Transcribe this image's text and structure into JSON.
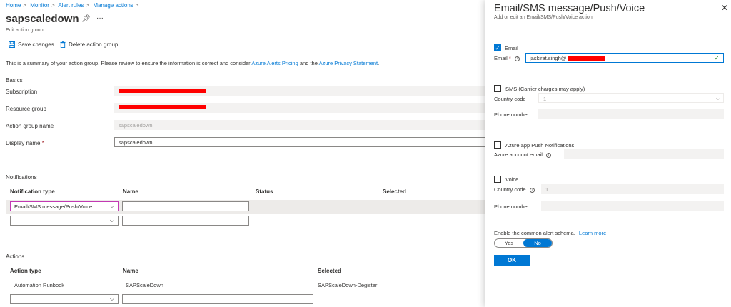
{
  "breadcrumb": [
    "Home",
    "Monitor",
    "Alert rules",
    "Manage actions"
  ],
  "page": {
    "title": "sapscaledown",
    "subtitle": "Edit action group"
  },
  "toolbar": {
    "save_label": "Save changes",
    "delete_label": "Delete action group"
  },
  "summary": {
    "text_before": "This is a summary of your action group. Please review to ensure the information is correct and consider ",
    "link1": "Azure Alerts Pricing",
    "text_mid": " and the ",
    "link2": "Azure Privacy Statement",
    "text_after": "."
  },
  "basics": {
    "heading": "Basics",
    "subscription_label": "Subscription",
    "resource_group_label": "Resource group",
    "action_group_name_label": "Action group name",
    "action_group_name_value": "sapscaledown",
    "display_name_label": "Display name",
    "display_name_value": "sapscaledown",
    "required_mark": "*"
  },
  "notifications": {
    "heading": "Notifications",
    "columns": [
      "Notification type",
      "Name",
      "Status",
      "Selected"
    ],
    "row1_type": "Email/SMS message/Push/Voice",
    "row1_name": "",
    "row2_type": "",
    "row2_name": ""
  },
  "actions": {
    "heading": "Actions",
    "columns": [
      "Action type",
      "Name",
      "Selected"
    ],
    "row1": {
      "type": "Automation Runbook",
      "name": "SAPScaleDown",
      "selected": "SAPScaleDown-Degister"
    },
    "row2_type": "",
    "row2_name": ""
  },
  "panel": {
    "title": "Email/SMS message/Push/Voice",
    "subtitle": "Add or edit an Email/SMS/Push/Voice action",
    "email": {
      "checkbox_label": "Email",
      "field_label": "Email",
      "required_mark": "*",
      "value": "jaskirat.singh@",
      "checked": true
    },
    "sms": {
      "checkbox_label": "SMS (Carrier charges may apply)",
      "country_label": "Country code",
      "country_value": "1",
      "phone_label": "Phone number",
      "checked": false
    },
    "push": {
      "checkbox_label": "Azure app Push Notifications",
      "account_label": "Azure account email",
      "checked": false
    },
    "voice": {
      "checkbox_label": "Voice",
      "country_label": "Country code",
      "country_value": "1",
      "phone_label": "Phone number",
      "checked": false
    },
    "schema": {
      "label": "Enable the common alert schema.",
      "link": "Learn more",
      "yes": "Yes",
      "no": "No",
      "selected": "No"
    },
    "ok_label": "OK"
  },
  "colors": {
    "accent": "#0078d4",
    "redaction": "#ff0000",
    "focus": "#c239b3"
  }
}
